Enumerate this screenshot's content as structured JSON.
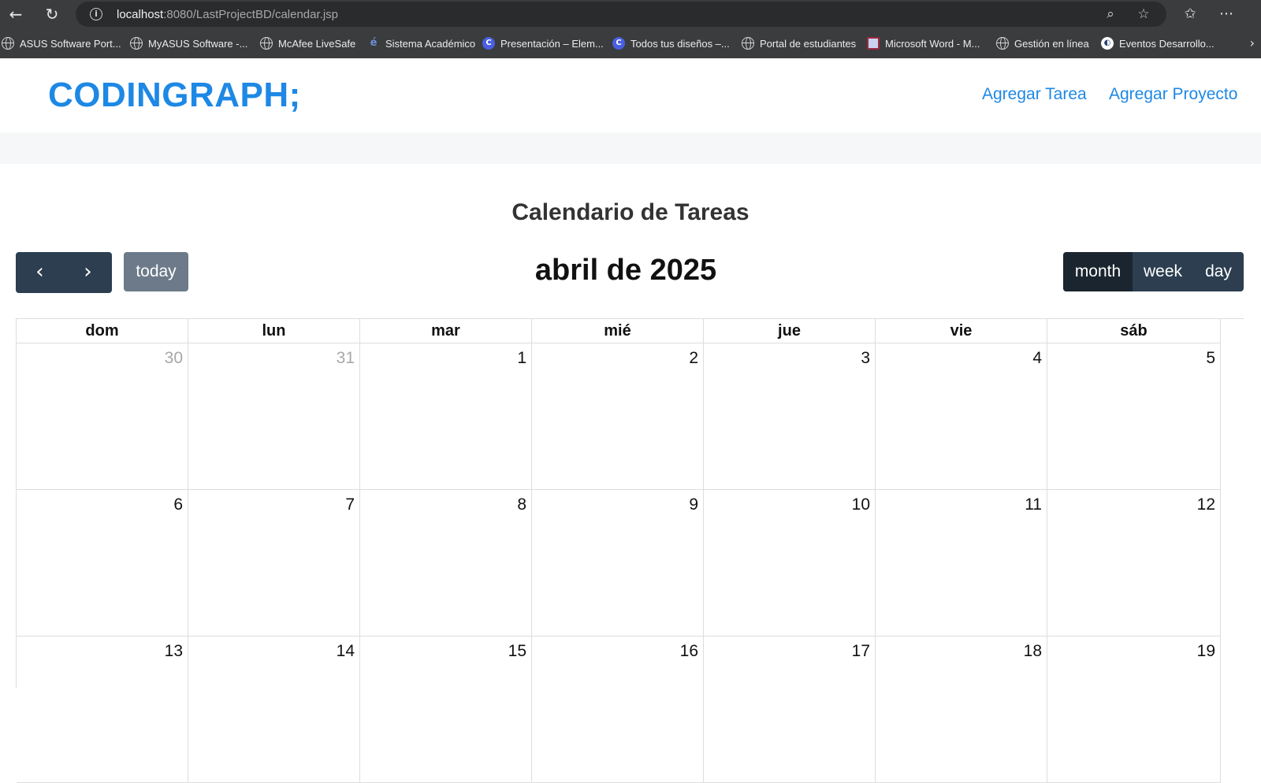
{
  "browser": {
    "url_host": "localhost",
    "url_rest": ":8080/LastProjectBD/calendar.jsp",
    "icons": [
      "back-icon",
      "reload-icon",
      "info-icon",
      "zoom-icon",
      "star-icon",
      "favorites-icon",
      "more-icon"
    ],
    "bookmarks": [
      {
        "label": "ASUS Software Port...",
        "icon": "globe"
      },
      {
        "label": "MyASUS Software -...",
        "icon": "globe"
      },
      {
        "label": "McAfee LiveSafe",
        "icon": "globe"
      },
      {
        "label": "Sistema Académico",
        "icon": "edu"
      },
      {
        "label": "Presentación – Elem...",
        "icon": "canva"
      },
      {
        "label": "Todos tus diseños –...",
        "icon": "canva"
      },
      {
        "label": "Portal de estudiantes",
        "icon": "globe"
      },
      {
        "label": "Microsoft Word - M...",
        "icon": "word"
      },
      {
        "label": "Gestión en línea",
        "icon": "globe"
      },
      {
        "label": "Eventos Desarrollo...",
        "icon": "ev"
      }
    ]
  },
  "navbar": {
    "brand": "CODINGRAPH;",
    "links": [
      "Agregar Tarea",
      "Agregar Proyecto"
    ]
  },
  "calendar": {
    "heading": "Calendario de Tareas",
    "toolbar": {
      "prev": "‹",
      "next": "›",
      "today": "today",
      "title": "abril de 2025",
      "views": [
        "month",
        "week",
        "day"
      ],
      "active_view": "month"
    },
    "day_headers": [
      "dom",
      "lun",
      "mar",
      "mié",
      "jue",
      "vie",
      "sáb"
    ],
    "weeks": [
      [
        {
          "d": "30",
          "other": true
        },
        {
          "d": "31",
          "other": true
        },
        {
          "d": "1"
        },
        {
          "d": "2"
        },
        {
          "d": "3"
        },
        {
          "d": "4"
        },
        {
          "d": "5"
        }
      ],
      [
        {
          "d": "6"
        },
        {
          "d": "7"
        },
        {
          "d": "8"
        },
        {
          "d": "9"
        },
        {
          "d": "10"
        },
        {
          "d": "11"
        },
        {
          "d": "12"
        }
      ],
      [
        {
          "d": "13"
        },
        {
          "d": "14"
        },
        {
          "d": "15"
        },
        {
          "d": "16"
        },
        {
          "d": "17"
        },
        {
          "d": "18"
        },
        {
          "d": "19"
        }
      ]
    ]
  }
}
